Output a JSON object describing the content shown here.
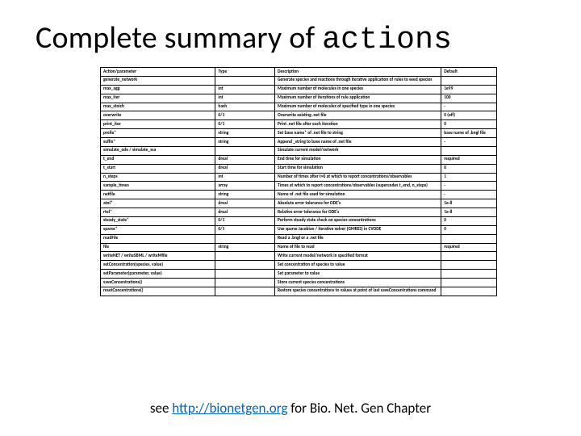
{
  "title_prefix": "Complete summary of ",
  "title_mono": "actions",
  "headers": {
    "action": "Action/parameter",
    "type": "Type",
    "description": "Description",
    "default": "Default"
  },
  "sections": [
    {
      "head": {
        "action": "generate_network",
        "type": "",
        "desc": "Generate species and reactions through iterative application of rules to seed species",
        "def": ""
      },
      "rows": [
        {
          "action": "max_agg",
          "type": "int",
          "desc": "Maximum number of molecules in one species",
          "def": "1e99"
        },
        {
          "action": "max_iter",
          "type": "int",
          "desc": "Maximum number of iterations of rule application",
          "def": "100"
        },
        {
          "action": "max_stoich",
          "type": "hash",
          "desc": "Maximum number of molecules of specified type in one species",
          "def": "-"
        },
        {
          "action": "overwrite",
          "type": "0/1",
          "desc": "Overwrite existing .net file",
          "def": "0 (off)"
        },
        {
          "action": "print_iter",
          "type": "0/1",
          "desc": "Print .net file after each iteration",
          "def": "0"
        },
        {
          "action": "prefix*",
          "type": "string",
          "desc": "Set base name* of .net file to string",
          "def": "base name of .bngl file"
        },
        {
          "action": "suffix*",
          "type": "string",
          "desc": "Append _string to base name of .net file",
          "def": "-"
        }
      ]
    },
    {
      "head": {
        "action": "simulate_ode / simulate_ssa",
        "type": "",
        "desc": "Simulate current model/network",
        "def": ""
      },
      "rows": [
        {
          "action": "t_end",
          "type": "dreal",
          "desc": "End time for simulation",
          "def": "required"
        },
        {
          "action": "t_start",
          "type": "dreal",
          "desc": "Start time for simulation",
          "def": "0"
        },
        {
          "action": "n_steps",
          "type": "int",
          "desc": "Number of times after t=0 at which to report concentrations/observables",
          "def": "1"
        },
        {
          "action": "sample_times",
          "type": "array",
          "desc": "Times at which to report concentrations/observables (supercedes t_end, n_steps)",
          "def": "-"
        },
        {
          "action": "netfile",
          "type": "string",
          "desc": "Name of .net file used for simulation",
          "def": "-"
        },
        {
          "action": "atol*",
          "type": "dreal",
          "desc": "Absolute error tolerance for ODE's",
          "def": "1e-8"
        },
        {
          "action": "rtol*",
          "type": "dreal",
          "desc": "Relative error tolerance for ODE's",
          "def": "1e-8"
        },
        {
          "action": "steady_state*",
          "type": "0/1",
          "desc": "Perform steady state check on species concentrations",
          "def": "0"
        },
        {
          "action": "sparse*",
          "type": "0/1",
          "desc": "Use sparse Jacobian / iterative solver (GMRES) in CVODE",
          "def": "0"
        }
      ]
    },
    {
      "head": {
        "action": "readFile",
        "type": "",
        "desc": "Read a .bngl or a .net file",
        "def": ""
      },
      "rows": [
        {
          "action": "file",
          "type": "string",
          "desc": "Name of file to read",
          "def": "required"
        }
      ]
    },
    {
      "head": {
        "action": "writeNET / writeSBML / writeMfile",
        "type": "",
        "desc": "Write current model/network in specified format",
        "def": ""
      },
      "rows": []
    },
    {
      "head": {
        "action": "setConcentration(species, value)",
        "type": "",
        "desc": "Set concentration of species to value",
        "def": ""
      },
      "rows": []
    },
    {
      "head": {
        "action": "setParameter(parameter, value)",
        "type": "",
        "desc": "Set parameter to value",
        "def": ""
      },
      "rows": []
    },
    {
      "head": {
        "action": "saveConcentrations()",
        "type": "",
        "desc": "Store current species concentrations",
        "def": ""
      },
      "rows": []
    },
    {
      "head": {
        "action": "resetConcentrations()",
        "type": "",
        "desc": "Restore species concentrations to values at point of last saveConcentrations command",
        "def": ""
      },
      "rows": []
    }
  ],
  "footer": {
    "pre": "see ",
    "link": "http://bionetgen.org",
    "post": " for Bio. Net. Gen Chapter"
  }
}
